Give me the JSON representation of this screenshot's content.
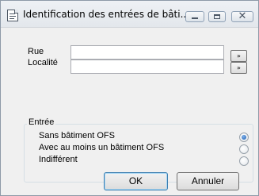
{
  "window": {
    "title": "Identification des entrées de bâti...",
    "icon": "document-icon",
    "controls": {
      "minimize_icon": "minimize-icon",
      "maximize_icon": "maximize-icon",
      "close_icon": "close-icon",
      "close_glyph": "✕"
    }
  },
  "form": {
    "street_label": "Rue",
    "street_value": "",
    "street_button": "»",
    "locality_label": "Localité",
    "locality_value": "",
    "locality_button": "»"
  },
  "entry_group": {
    "legend": "Entrée",
    "options": [
      {
        "label": "Sans bâtiment OFS",
        "selected": true
      },
      {
        "label": "Avec au moins un bâtiment OFS",
        "selected": false
      },
      {
        "label": "Indifférent",
        "selected": false
      }
    ]
  },
  "buttons": {
    "ok": "OK",
    "cancel": "Annuler"
  },
  "colors": {
    "dialog_background": "#f0f0f0",
    "radio_selected": "#1d5fb4",
    "default_button_border": "#3c7fb1"
  }
}
